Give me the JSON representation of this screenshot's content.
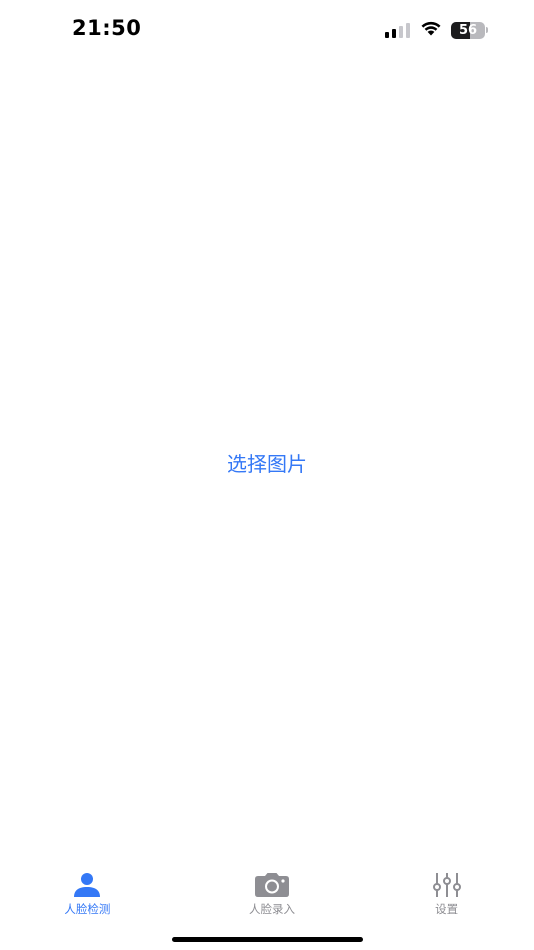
{
  "status_bar": {
    "time": "21:50",
    "battery_level": "56",
    "battery_percent": 56,
    "signal_bars_active": 2,
    "signal_bars_total": 4
  },
  "main": {
    "pick_image_label": "选择图片"
  },
  "tab_bar": {
    "tabs": [
      {
        "label": "人脸检测",
        "icon": "person-icon",
        "active": true
      },
      {
        "label": "人脸录入",
        "icon": "camera-icon",
        "active": false
      },
      {
        "label": "设置",
        "icon": "sliders-icon",
        "active": false
      }
    ]
  },
  "colors": {
    "accent": "#3478f6",
    "inactive": "#8e8e93",
    "background": "#ffffff"
  }
}
